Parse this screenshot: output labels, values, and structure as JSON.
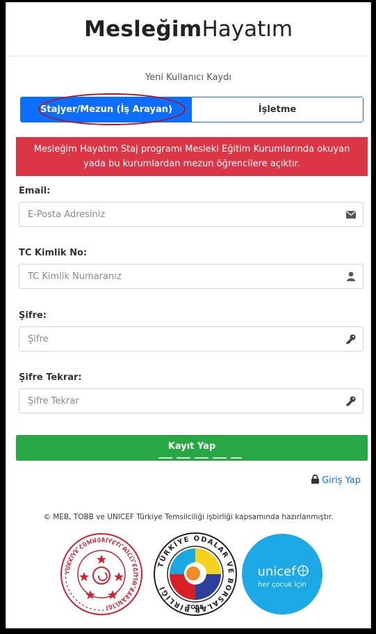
{
  "brand": {
    "bold": "Mesleğim",
    "normal": "Hayatım"
  },
  "subtitle": "Yeni Kullanıcı Kaydı",
  "tabs": [
    {
      "label": "Stajyer/Mezun (İş Arayan)",
      "active": true
    },
    {
      "label": "İşletme",
      "active": false
    }
  ],
  "alert": "Mesleğim Hayatım Staj programı Mesleki Eğitim Kurumlarında okuyan yada bu kurumlardan mezun öğrencilere açıktır.",
  "form": {
    "email": {
      "label": "Email:",
      "placeholder": "E-Posta Adresiniz",
      "value": "",
      "icon": "envelope-icon"
    },
    "tc": {
      "label": "TC Kimlik No:",
      "placeholder": "TC Kimlik Numaranız",
      "value": "",
      "icon": "user-icon"
    },
    "password": {
      "label": "Şifre:",
      "placeholder": "Şifre",
      "value": "",
      "icon": "key-icon"
    },
    "password_repeat": {
      "label": "Şifre Tekrar:",
      "placeholder": "Şifre Tekrar",
      "value": "",
      "icon": "key-icon"
    }
  },
  "submit_label": "Kayıt Yap",
  "login_label": "Giriş Yap",
  "footer_note": "© MEB, TOBB ve UNICEF Türkiye Temsilciliği işbirliği kapsamında hazırlanmıştır.",
  "logos": {
    "meb_text": "TÜRKİYE CUMHURİYETİ MİLLİ EĞİTİM BAKANLIĞI",
    "tobb_ring": "TÜRKİYE ODALAR VE BORSALAR BİRLİĞİ",
    "tobb_abbr": "TOBB",
    "unicef_name": "unicef",
    "unicef_tagline": "her çocuk için"
  },
  "colors": {
    "primary": "#0d6efd",
    "danger": "#dc3545",
    "success": "#28a745",
    "unicef_blue": "#1ca9e6",
    "meb_red": "#d3202f"
  }
}
